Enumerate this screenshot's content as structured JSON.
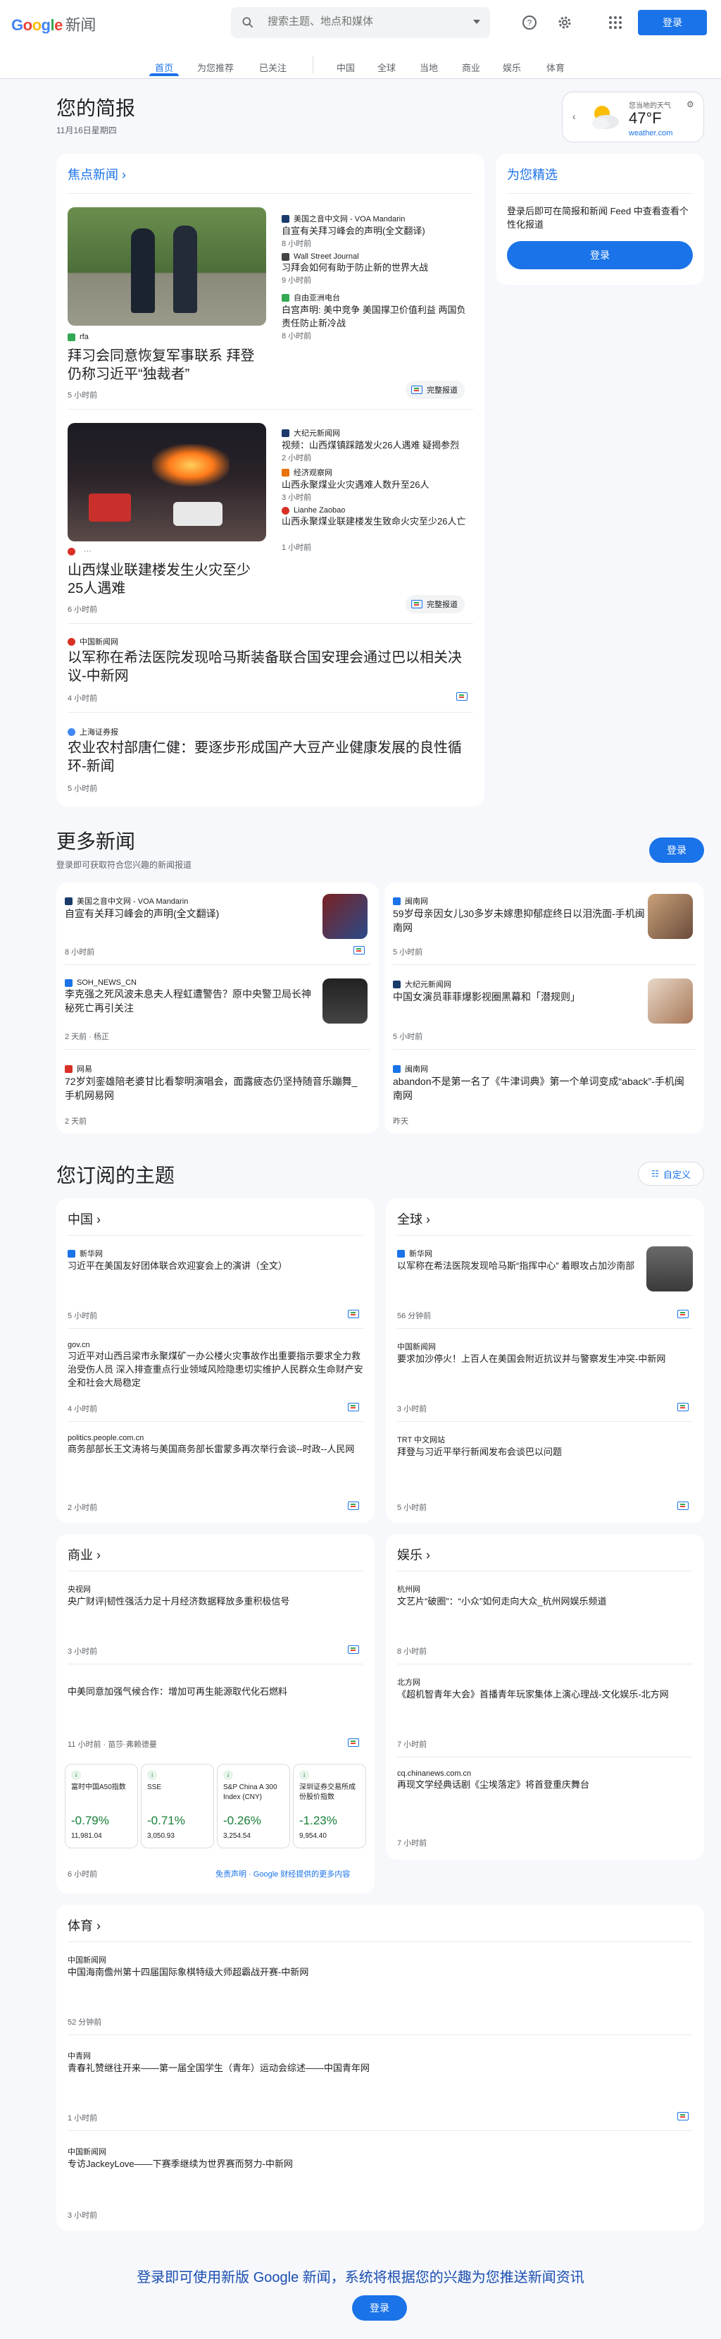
{
  "header": {
    "logo_google": "Google",
    "logo_news": "新闻",
    "search_placeholder": "搜索主题、地点和媒体",
    "signin": "登录"
  },
  "tabs": [
    "首页",
    "为您推荐",
    "已关注",
    "中国",
    "全球",
    "当地",
    "商业",
    "娱乐",
    "体育"
  ],
  "briefing": {
    "title": "您的简报",
    "date": "11月16日星期四"
  },
  "weather": {
    "label": "您当地的天气",
    "temp": "47°F",
    "source": "weather.com"
  },
  "top": {
    "heading": "焦点新闻",
    "full_coverage": "完整报道",
    "story1": {
      "source": "rfa",
      "title": "拜习会同意恢复军事联系 拜登仍称习近平“独裁者”",
      "time": "5 小时前",
      "related": [
        {
          "source": "美国之音中文网 - VOA Mandarin",
          "title": "自宣有关拜习峰会的声明(全文翻译)",
          "time": "8 小时前",
          "color": "#1a3a6b"
        },
        {
          "source": "Wall Street Journal",
          "title": "习拜会如何有助于防止新的世界大战",
          "time": "9 小时前",
          "color": "#444444"
        },
        {
          "source": "自由亚洲电台",
          "title": "白宫声明: 美中竞争 美国撑卫价值利益 两国负责任防止新冷战",
          "time": "8 小时前",
          "color": "#34a853"
        }
      ]
    },
    "story2": {
      "source": "",
      "title": "山西煤业联建楼发生火灾至少25人遇难",
      "time": "6 小时前",
      "related": [
        {
          "source": "大纪元新闻网",
          "title": "视频：山西煤镇踩踏发火26人遇难 疑揭参烈",
          "time": "2 小时前",
          "color": "#1a3a6b"
        },
        {
          "source": "经济观察网",
          "title": "山西永聚煤业火灾遇难人数升至26人",
          "time": "3 小时前",
          "color": "#e8710a"
        },
        {
          "source": "Lianhe Zaobao",
          "title": "山西永聚煤业联建楼发生致命火灾至少26人亡",
          "time": "1 小时前",
          "color": "#d93025"
        }
      ]
    },
    "story3": {
      "source": "中国新闻网",
      "title": "以军称在希法医院发现哈马斯装备联合国安理会通过巴以相关决议-中新网",
      "time": "4 小时前"
    },
    "story4": {
      "source": "上海证券报",
      "title": "农业农村部唐仁健：要逐步形成国产大豆产业健康发展的良性循环-新闻",
      "time": "5 小时前"
    }
  },
  "picks": {
    "heading": "为您精选",
    "text": "登录后即可在简报和新闻 Feed 中查看查看个性化报道",
    "signin": "登录"
  },
  "more": {
    "title": "更多新闻",
    "sub": "登录即可获取符合您兴趣的新闻报道",
    "signin": "登录",
    "items": [
      {
        "source": "美国之音中文网 - VOA Mandarin",
        "title": "自宣有关拜习峰会的声明(全文翻译)",
        "time": "8 小时前"
      },
      {
        "source": "闽南网",
        "title": "59岁母亲因女儿30多岁未嫁患抑郁症终日以泪洗面-手机闽南网",
        "time": "5 小时前"
      },
      {
        "source": "SOH_NEWS_CN",
        "title": "李克强之死风波未息夫人程虹遭警告？原中央警卫局长神秘死亡再引关注",
        "time": "2 天前 · 杨正"
      },
      {
        "source": "大纪元新闻网",
        "title": "中国女演员菲菲爆影视圈黑幕和「潜规则」",
        "time": "5 小时前"
      },
      {
        "source": "网易",
        "title": "72岁刘銮雄陪老婆甘比看黎明演唱会，面露疲态仍坚持随音乐蹦舞_手机网易网",
        "time": "2 天前"
      },
      {
        "source": "闽南网",
        "title": "abandon不是第一名了《牛津词典》第一个单词变成“aback”-手机闽南网",
        "time": "昨天"
      }
    ]
  },
  "topics": {
    "title": "您订阅的主题",
    "customize": "自定义",
    "china": {
      "label": "中国",
      "items": [
        {
          "source": "新华网",
          "title": "习近平在美国友好团体联合欢迎宴会上的演讲（全文）",
          "time": "5 小时前"
        },
        {
          "source": "gov.cn",
          "title": "习近平对山西吕梁市永聚煤矿一办公楼火灾事故作出重要指示要求全力救治受伤人员 深入排查重点行业领域风险隐患切实维护人民群众生命财产安全和社会大局稳定",
          "time": "4 小时前"
        },
        {
          "source": "politics.people.com.cn",
          "title": "商务部部长王文涛将与美国商务部长雷蒙多再次举行会谈--时政--人民网",
          "time": "2 小时前"
        }
      ]
    },
    "world": {
      "label": "全球",
      "items": [
        {
          "source": "新华网",
          "title": "以军称在希法医院发现哈马斯“指挥中心” 着眼攻占加沙南部",
          "time": "56 分钟前"
        },
        {
          "source": "中国新闻网",
          "title": "要求加沙停火！上百人在美国会附近抗议并与警察发生冲突-中新网",
          "time": "3 小时前"
        },
        {
          "source": "TRT 中文网站",
          "title": "拜登与习近平举行新闻发布会谈巴以问题",
          "time": "5 小时前"
        }
      ]
    },
    "business": {
      "label": "商业",
      "items": [
        {
          "source": "央视网",
          "title": "央广财评|韧性强活力足十月经济数据释放多重积极信号",
          "time": "3 小时前"
        },
        {
          "source": "",
          "title": "中美同意加强气候合作：增加可再生能源取代化石燃料",
          "time": "11 小时前 · 苗莎·弗赖德曼"
        }
      ],
      "stocks": [
        {
          "name": "富时中国A50指数",
          "change": "-0.79%",
          "value": "11,981.04"
        },
        {
          "name": "SSE",
          "change": "-0.71%",
          "value": "3,050.93"
        },
        {
          "name": "S&P China A 300 Index (CNY)",
          "change": "-0.26%",
          "value": "3,254.54"
        },
        {
          "name": "深圳证券交易所成份股价指数",
          "change": "-1.23%",
          "value": "9,954.40"
        }
      ],
      "stocks_time": "6 小时前",
      "disclaimer": "免责声明",
      "finance_link": "· Google 财经提供的更多内容"
    },
    "ent": {
      "label": "娱乐",
      "items": [
        {
          "source": "杭州网",
          "title": "文艺片“破圈”：“小众”如何走向大众_杭州网娱乐频道",
          "time": "8 小时前"
        },
        {
          "source": "北方网",
          "title": "《超机智青年大会》首播青年玩家集体上演心理战-文化娱乐-北方网",
          "time": "7 小时前"
        },
        {
          "source": "cq.chinanews.com.cn",
          "title": "再现文学经典话剧《尘埃落定》将首登重庆舞台",
          "time": "7 小时前"
        }
      ]
    },
    "sports": {
      "label": "体育",
      "items": [
        {
          "source": "中国新闻网",
          "title": "中国海南儋州第十四届国际象棋特级大师超霸战开赛-中新网",
          "time": "52 分钟前"
        },
        {
          "source": "中青网",
          "title": "青春礼赞继往开来——第一届全国学生（青年）运动会综述——中国青年网",
          "time": "1 小时前"
        },
        {
          "source": "中国新闻网",
          "title": "专访JackeyLove——下赛季继续为世界赛而努力-中新网",
          "time": "3 小时前"
        }
      ]
    }
  },
  "footer": {
    "promo": "登录即可使用新版 Google 新闻，系统将根据您的兴趣为您推送新闻资讯",
    "signin": "登录"
  }
}
